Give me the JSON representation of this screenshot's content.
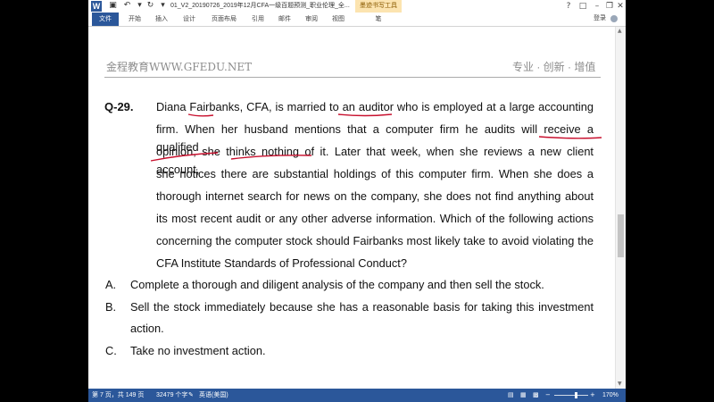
{
  "titlebar": {
    "app_icon": "W",
    "doc_title": "01_V2_20190726_2019年12月CFA一级百题预测_职业伦理_全...",
    "context_tool": "墨迹书写工具",
    "icons": [
      "save-icon",
      "undo-icon",
      "redo-icon",
      "customize-icon",
      "help-icon",
      "minimize-icon",
      "restore-icon",
      "close-icon"
    ]
  },
  "ribbon": {
    "tabs": [
      "文件",
      "开始",
      "插入",
      "设计",
      "页面布局",
      "引用",
      "邮件",
      "审阅",
      "视图"
    ],
    "pen_tab": "笔",
    "login": "登录"
  },
  "header": {
    "left": "金程教育WWW.GFEDU.NET",
    "right": "专业 · 创新 · 增值"
  },
  "question": {
    "number": "Q-29.",
    "lines": [
      "Diana Fairbanks, CFA, is married to an auditor who is employed at a large accounting",
      "firm. When her husband mentions that a computer firm he audits will receive a qualified",
      "opinion, she thinks nothing of it. Later that week, when she reviews a new client account,",
      "she notices there are substantial holdings of this computer firm. When she does a",
      "thorough internet search for news on the company, she does not find anything about",
      "its most recent audit or any other adverse information. Which of the following actions",
      "concerning the computer stock should Fairbanks most likely take to avoid violating the",
      "CFA Institute Standards of Professional Conduct?"
    ],
    "options": [
      {
        "letter": "A.",
        "lines": [
          "Complete a thorough and diligent analysis of the company and then sell the stock."
        ]
      },
      {
        "letter": "B.",
        "lines": [
          "Sell the stock immediately because she has a reasonable basis for taking this investment",
          "action."
        ]
      },
      {
        "letter": "C.",
        "lines": [
          "Take no investment action."
        ]
      }
    ]
  },
  "status": {
    "page": "第 7 页，共 149 页",
    "words": "32479 个字",
    "language": "英语(美国)",
    "zoom": "170%"
  },
  "colors": {
    "accent": "#2b579a",
    "ink": "#c8102e",
    "header_text": "#8c8c8c"
  }
}
